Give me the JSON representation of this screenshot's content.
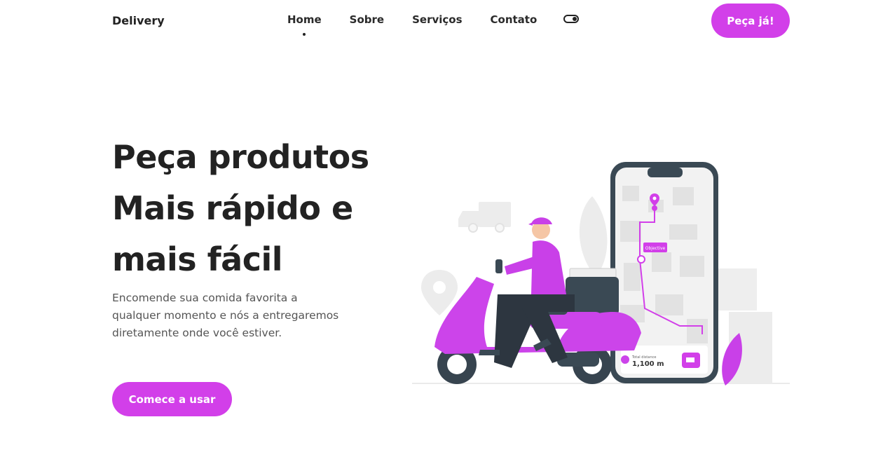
{
  "header": {
    "logo": "Delivery",
    "nav": [
      "Home",
      "Sobre",
      "Serviços",
      "Contato"
    ],
    "active_nav": "Home",
    "cta_label": "Peça já!"
  },
  "hero": {
    "title_lines": [
      "Peça produtos",
      "Mais rápido e",
      "mais fácil"
    ],
    "description": "Encomende sua comida favorita a qualquer momento e nós a entregaremos diretamente onde você estiver.",
    "cta_label": "Comece a usar"
  },
  "illustration": {
    "map_label": "Objective",
    "distance_caption": "Total distance",
    "distance_value": "1,100 m"
  },
  "colors": {
    "accent": "#d23fe9",
    "text_dark": "#222222",
    "text_body": "#555555"
  }
}
